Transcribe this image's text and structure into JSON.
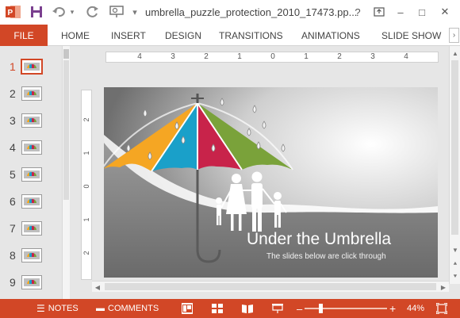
{
  "titlebar": {
    "doc_title": "umbrella_puzzle_protection_2010_17473.pp...",
    "app_icon": "powerpoint-icon",
    "save_icon": "save-icon",
    "undo_icon": "undo-icon",
    "redo_icon": "repeat-icon",
    "present_icon": "present-from-beginning-icon",
    "customize_icon": "customize-qat-icon",
    "help": "?",
    "restore": "❐",
    "minimize": "–",
    "maximize": "□",
    "close": "✕"
  },
  "ribbon": {
    "file": "FILE",
    "tabs": [
      "HOME",
      "INSERT",
      "DESIGN",
      "TRANSITIONS",
      "ANIMATIONS",
      "SLIDE SHOW"
    ],
    "collapse": "›"
  },
  "thumbnails": {
    "slides": [
      "1",
      "2",
      "3",
      "4",
      "5",
      "6",
      "7",
      "8",
      "9"
    ],
    "active": "1"
  },
  "ruler": {
    "horizontal": [
      "4",
      "3",
      "2",
      "1",
      "0",
      "1",
      "2",
      "3",
      "4"
    ],
    "vertical": [
      "2",
      "1",
      "0",
      "1",
      "2"
    ]
  },
  "slide": {
    "title": "Under the Umbrella",
    "subtitle": "The slides below are click through",
    "umbrella_colors": [
      "#f5a623",
      "#1aa0c9",
      "#c8234a",
      "#7aa23a"
    ]
  },
  "status": {
    "notes": "NOTES",
    "comments": "COMMENTS",
    "zoom_minus": "–",
    "zoom_plus": "+",
    "zoom": "44%",
    "zoom_level": 0.44
  },
  "colors": {
    "accent": "#d24726"
  }
}
